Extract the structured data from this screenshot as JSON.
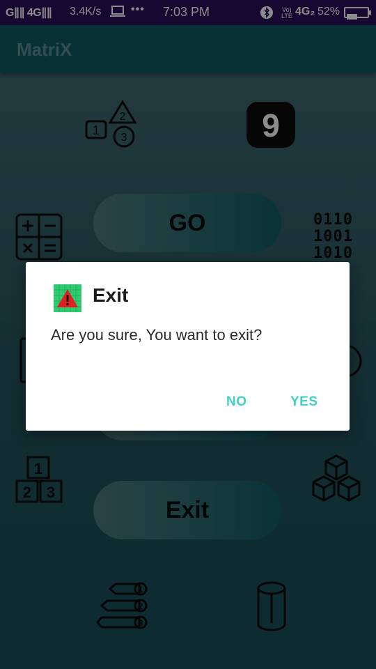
{
  "status_bar": {
    "signal1": "G∥∥ 4G∥∥",
    "speed": "3.4K/s",
    "laptop_icon": "laptop-icon",
    "dots": "•••",
    "time": "7:03 PM",
    "bluetooth": "ʙ",
    "volte": "Vo)\nLTE",
    "network2": "4G₂",
    "battery_pct": "52%",
    "battery_level": 0.52
  },
  "app_bar": {
    "title": "MatriX"
  },
  "main": {
    "icons": [
      {
        "name": "shapes-numbers-icon"
      },
      {
        "name": "number-nine-icon",
        "text": "9"
      },
      {
        "name": "calculator-icon"
      },
      {
        "name": "binary-icon",
        "lines": [
          "0110",
          "1001",
          "1010"
        ]
      },
      {
        "name": "numbers-123-icon",
        "digits": [
          "1",
          "2",
          "3"
        ]
      },
      {
        "name": "cubes-icon"
      },
      {
        "name": "ordered-list-arrows-icon",
        "digits": [
          "1",
          "2",
          "3"
        ]
      },
      {
        "name": "cylinder-icon"
      }
    ],
    "buttons": {
      "go": "GO",
      "exit": "Exit"
    }
  },
  "dialog": {
    "title": "Exit",
    "message": "Are you sure, You want to exit?",
    "no": "NO",
    "yes": "YES",
    "icon": "warning-icon",
    "colors": {
      "accent": "#3fd0c8",
      "icon_bg": "#2ecc71",
      "warning_red": "#e02020"
    }
  }
}
